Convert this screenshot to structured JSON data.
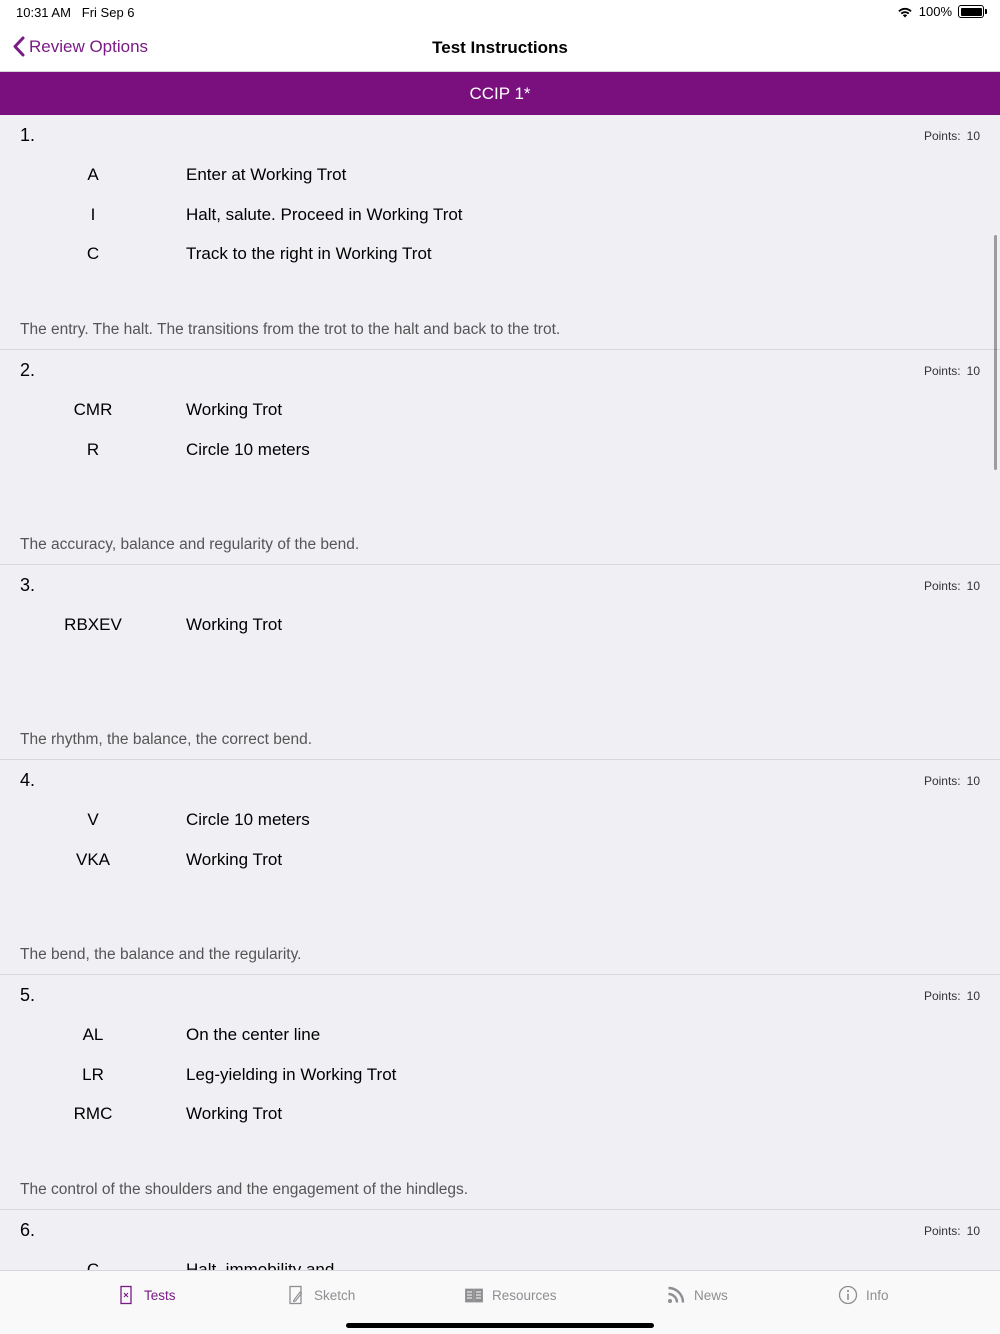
{
  "status": {
    "time": "10:31 AM",
    "date": "Fri Sep 6",
    "battery": "100%"
  },
  "nav": {
    "back_label": "Review Options",
    "title": "Test Instructions"
  },
  "test_name": "CCIP 1*",
  "points_label": "Points:",
  "movements": [
    {
      "number": "1.",
      "points": "10",
      "rows": [
        {
          "letter": "A",
          "instruction": "Enter at Working Trot"
        },
        {
          "letter": "I",
          "instruction": "Halt, salute.  Proceed in Working Trot"
        },
        {
          "letter": "C",
          "instruction": "Track to the right in Working Trot"
        }
      ],
      "directive": "The entry. The halt. The transitions from the trot to the halt and back to the trot."
    },
    {
      "number": "2.",
      "points": "10",
      "rows": [
        {
          "letter": "CMR",
          "instruction": "Working Trot"
        },
        {
          "letter": "R",
          "instruction": "Circle 10 meters"
        }
      ],
      "directive": "The accuracy, balance and regularity of the bend."
    },
    {
      "number": "3.",
      "points": "10",
      "rows": [
        {
          "letter": "RBXEV",
          "instruction": "Working Trot"
        }
      ],
      "directive": "The rhythm, the balance, the correct bend."
    },
    {
      "number": "4.",
      "points": "10",
      "rows": [
        {
          "letter": "V",
          "instruction": "Circle 10 meters"
        },
        {
          "letter": "VKA",
          "instruction": "Working Trot"
        }
      ],
      "directive": "The bend, the balance and the regularity."
    },
    {
      "number": "5.",
      "points": "10",
      "rows": [
        {
          "letter": "AL",
          "instruction": "On the center line"
        },
        {
          "letter": "LR",
          "instruction": "Leg-yielding in Working Trot"
        },
        {
          "letter": "RMC",
          "instruction": "Working Trot"
        }
      ],
      "directive": "The control of the shoulders and the engagement of the hindlegs."
    },
    {
      "number": "6.",
      "points": "10",
      "rows": [
        {
          "letter": "C",
          "instruction": "Halt, immobility and"
        }
      ],
      "directive": ""
    }
  ],
  "tabs": [
    {
      "label": "Tests",
      "icon": "test-sheet-icon",
      "active": true
    },
    {
      "label": "Sketch",
      "icon": "sketch-icon",
      "active": false
    },
    {
      "label": "Resources",
      "icon": "book-icon",
      "active": false
    },
    {
      "label": "News",
      "icon": "rss-icon",
      "active": false
    },
    {
      "label": "Info",
      "icon": "info-icon",
      "active": false
    }
  ],
  "colors": {
    "accent": "#7a1a86",
    "banner": "#7a0f7e",
    "background": "#f0eff4",
    "tab_inactive": "#8e8e93"
  }
}
